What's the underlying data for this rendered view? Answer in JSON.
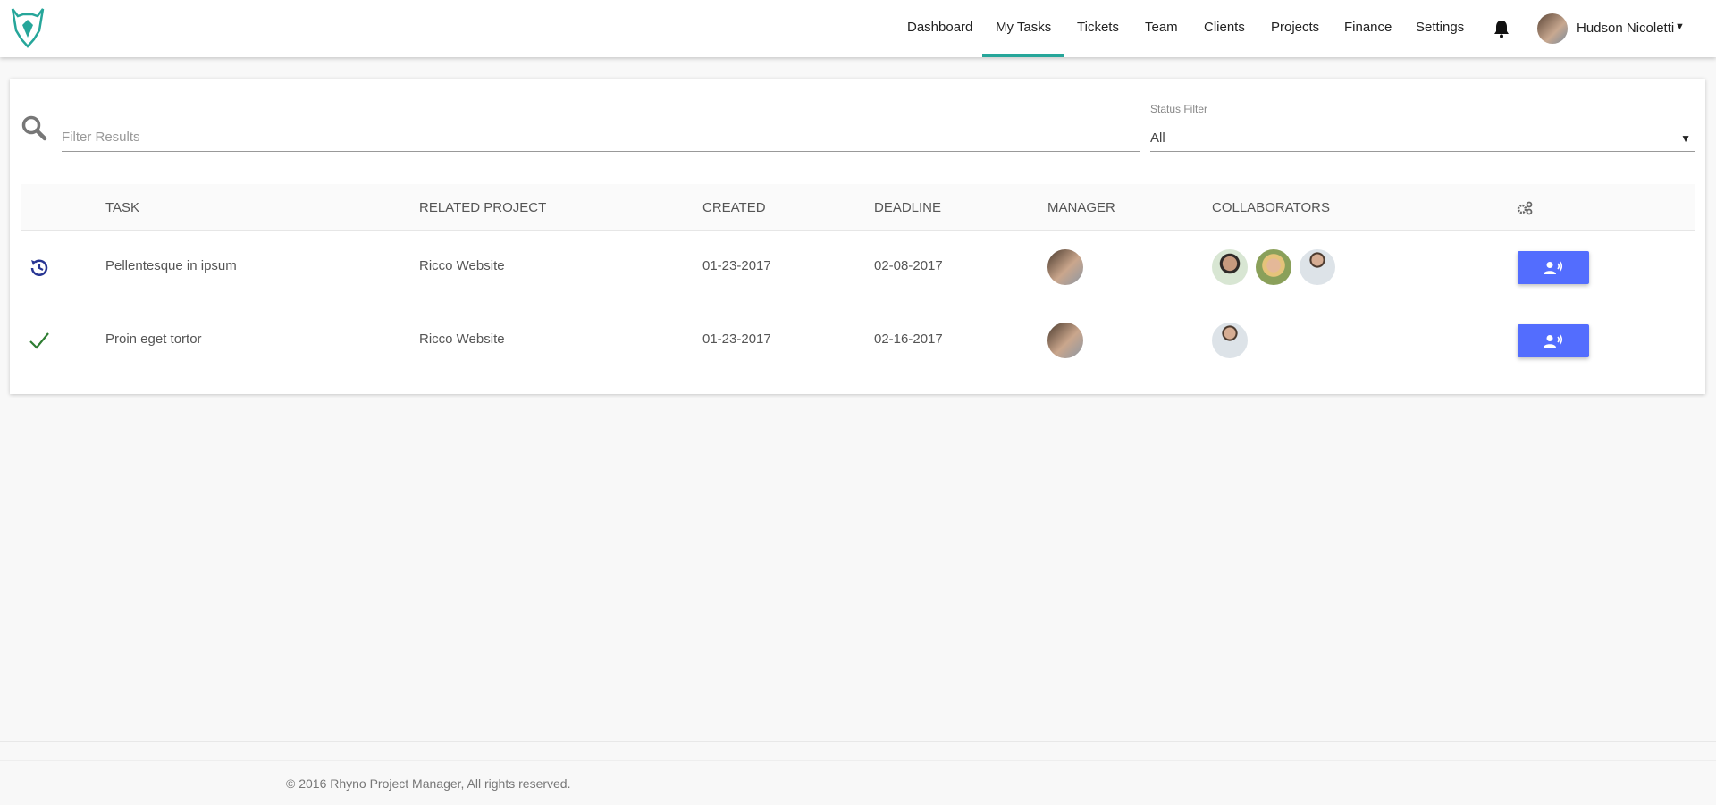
{
  "nav": {
    "items": [
      {
        "label": "Dashboard",
        "active": false
      },
      {
        "label": "My Tasks",
        "active": true
      },
      {
        "label": "Tickets",
        "active": false
      },
      {
        "label": "Team",
        "active": false
      },
      {
        "label": "Clients",
        "active": false
      },
      {
        "label": "Projects",
        "active": false
      },
      {
        "label": "Finance",
        "active": false
      },
      {
        "label": "Settings",
        "active": false
      }
    ],
    "user_name": "Hudson Nicoletti",
    "accent": "#26a69a"
  },
  "filters": {
    "search_placeholder": "Filter Results",
    "search_value": "",
    "status_label": "Status Filter",
    "status_value": "All"
  },
  "table": {
    "headers": [
      "TASK",
      "RELATED PROJECT",
      "CREATED",
      "DEADLINE",
      "MANAGER",
      "COLLABORATORS"
    ],
    "rows": [
      {
        "status_icon": "clock-refresh-icon",
        "task": "Pellentesque in ipsum",
        "project": "Ricco Website",
        "created": "01-23-2017",
        "deadline": "02-08-2017",
        "collaborators": 3
      },
      {
        "status_icon": "check-icon",
        "task": "Proin eget tortor",
        "project": "Ricco Website",
        "created": "01-23-2017",
        "deadline": "02-16-2017",
        "collaborators": 1
      }
    ]
  },
  "colors": {
    "button": "#536dfe",
    "pending": "#283593",
    "done": "#2e7d32"
  },
  "footer": {
    "text": "© 2016 Rhyno Project Manager, All rights reserved."
  }
}
